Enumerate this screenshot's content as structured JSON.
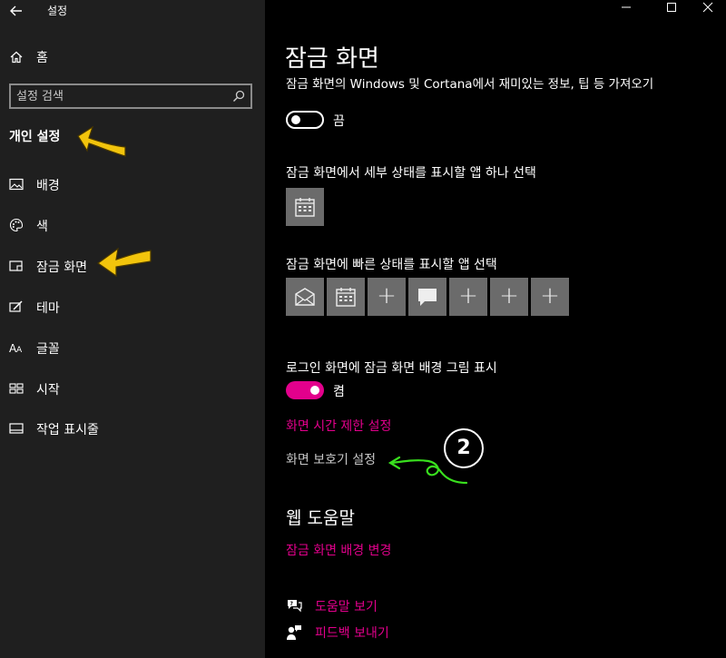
{
  "window": {
    "title": "설정",
    "controls": {
      "minimize": "—",
      "maximize": "☐",
      "close": "✕"
    }
  },
  "sidebar": {
    "home_label": "홈",
    "search_placeholder": "설정 검색",
    "section_heading": "개인 설정",
    "items": [
      {
        "label": "배경",
        "icon": "picture-icon"
      },
      {
        "label": "색",
        "icon": "palette-icon"
      },
      {
        "label": "잠금 화면",
        "icon": "lock-screen-icon"
      },
      {
        "label": "테마",
        "icon": "theme-icon"
      },
      {
        "label": "글꼴",
        "icon": "font-icon"
      },
      {
        "label": "시작",
        "icon": "start-icon"
      },
      {
        "label": "작업 표시줄",
        "icon": "taskbar-icon"
      }
    ]
  },
  "main": {
    "page_title": "잠금 화면",
    "cut_text": "잠금 화면의 Windows 및 Cortana에서 재미있는 정보, 팁 등 가져오기",
    "tips_toggle": {
      "state_label": "끔",
      "on": false
    },
    "detailed_status_label": "잠금 화면에서 세부 상태를 표시할 앱 하나 선택",
    "quick_status_label": "잠금 화면에 빠른 상태를 표시할 앱 선택",
    "quick_status_tiles": [
      "mail-icon",
      "calendar-icon",
      "+",
      "message-icon",
      "+",
      "+",
      "+"
    ],
    "signin_bg_label": "로그인 화면에 잠금 화면 배경 그림 표시",
    "signin_toggle": {
      "state_label": "켬",
      "on": true
    },
    "screen_timeout_link": "화면 시간 제한 설정",
    "screen_saver_link": "화면 보호기 설정",
    "web_help_heading": "웹 도움말",
    "web_help_link": "잠금 화면 배경 변경",
    "help_links": [
      {
        "label": "도움말 보기",
        "icon": "help-chat-icon"
      },
      {
        "label": "피드백 보내기",
        "icon": "feedback-icon"
      }
    ]
  },
  "annotations": {
    "step_badge": "2"
  },
  "colors": {
    "accent": "#e3008c",
    "sidebar_bg": "#1f1f1f",
    "main_bg": "#000000",
    "tile_bg": "#6b6b6b",
    "arrow_yellow": "#f2c40c",
    "arrow_green": "#39e01e"
  }
}
